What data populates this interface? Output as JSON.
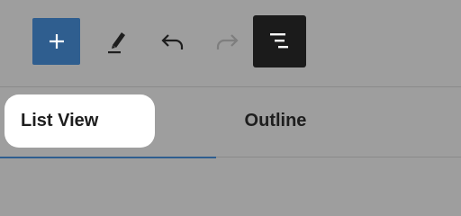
{
  "toolbar": {
    "add_icon": "plus-icon",
    "edit_icon": "pencil-icon",
    "undo_icon": "undo-icon",
    "redo_icon": "redo-icon",
    "document_overview_icon": "document-overview-icon",
    "colors": {
      "add_bg": "#2f5e8f",
      "overview_bg": "#1b1b1b"
    }
  },
  "tabs": [
    {
      "label": "List View",
      "active": true
    },
    {
      "label": "Outline",
      "active": false
    }
  ]
}
